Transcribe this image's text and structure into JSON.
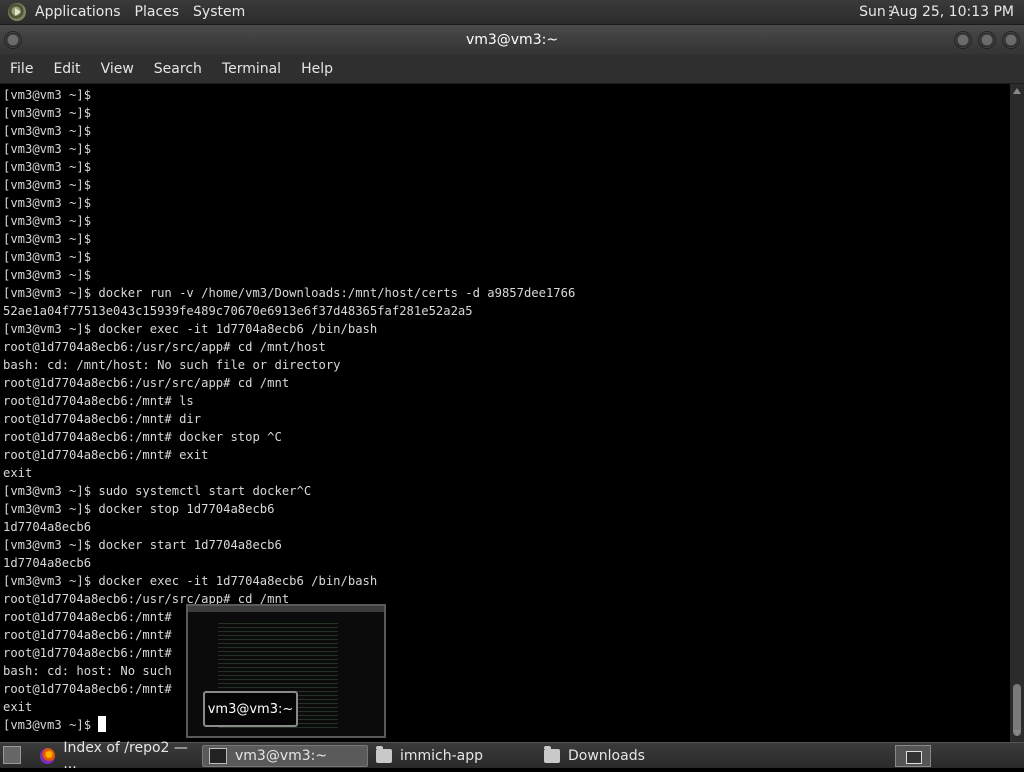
{
  "top_panel": {
    "menus": [
      "Applications",
      "Places",
      "System"
    ],
    "clock": "Sun Aug 25, 10:13 PM"
  },
  "window": {
    "title": "vm3@vm3:~",
    "menus": [
      "File",
      "Edit",
      "View",
      "Search",
      "Terminal",
      "Help"
    ]
  },
  "terminal": {
    "lines": [
      "[vm3@vm3 ~]$",
      "[vm3@vm3 ~]$",
      "[vm3@vm3 ~]$",
      "[vm3@vm3 ~]$",
      "[vm3@vm3 ~]$",
      "[vm3@vm3 ~]$",
      "[vm3@vm3 ~]$",
      "[vm3@vm3 ~]$",
      "[vm3@vm3 ~]$",
      "[vm3@vm3 ~]$",
      "[vm3@vm3 ~]$",
      "[vm3@vm3 ~]$ docker run -v /home/vm3/Downloads:/mnt/host/certs -d a9857dee1766",
      "52ae1a04f77513e043c15939fe489c70670e6913e6f37d48365faf281e52a2a5",
      "[vm3@vm3 ~]$ docker exec -it 1d7704a8ecb6 /bin/bash",
      "root@1d7704a8ecb6:/usr/src/app# cd /mnt/host",
      "bash: cd: /mnt/host: No such file or directory",
      "root@1d7704a8ecb6:/usr/src/app# cd /mnt",
      "root@1d7704a8ecb6:/mnt# ls",
      "root@1d7704a8ecb6:/mnt# dir",
      "root@1d7704a8ecb6:/mnt# docker stop ^C",
      "root@1d7704a8ecb6:/mnt# exit",
      "exit",
      "[vm3@vm3 ~]$ sudo systemctl start docker^C",
      "[vm3@vm3 ~]$ docker stop 1d7704a8ecb6",
      "1d7704a8ecb6",
      "[vm3@vm3 ~]$ docker start 1d7704a8ecb6",
      "1d7704a8ecb6",
      "[vm3@vm3 ~]$ docker exec -it 1d7704a8ecb6 /bin/bash",
      "root@1d7704a8ecb6:/usr/src/app# cd /mnt",
      "root@1d7704a8ecb6:/mnt#",
      "root@1d7704a8ecb6:/mnt#",
      "root@1d7704a8ecb6:/mnt#",
      "bash: cd: host: No such",
      "root@1d7704a8ecb6:/mnt#",
      "exit",
      "[vm3@vm3 ~]$ "
    ]
  },
  "window_switcher": {
    "label": "vm3@vm3:~"
  },
  "taskbar": {
    "tasks": [
      {
        "label": "Index of /repo2 — ...",
        "icon": "firefox-icon"
      },
      {
        "label": "vm3@vm3:~",
        "icon": "terminal-icon",
        "active": true
      },
      {
        "label": "immich-app",
        "icon": "folder-icon"
      },
      {
        "label": "Downloads",
        "icon": "folder-icon"
      }
    ]
  }
}
